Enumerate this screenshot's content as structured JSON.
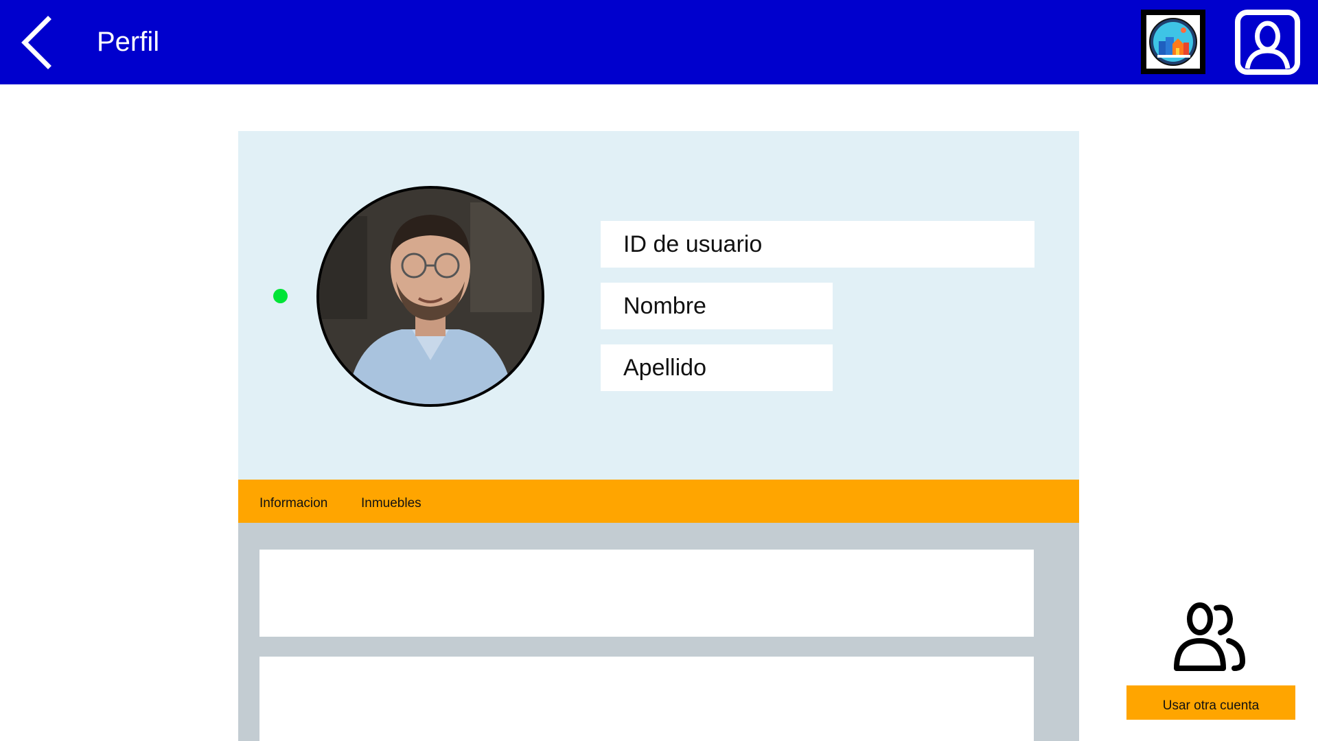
{
  "header": {
    "title": "Perfil",
    "back_icon": "chevron-left-icon",
    "logo_icon": "city-logo-icon",
    "account_icon": "user-account-icon"
  },
  "profile": {
    "status": "online",
    "avatar": "profile-photo",
    "fields": {
      "user_id_placeholder": "ID de usuario",
      "first_name_placeholder": "Nombre",
      "last_name_placeholder": "Apellido"
    }
  },
  "tabs": [
    {
      "label": "Informacion"
    },
    {
      "label": "Inmuebles"
    }
  ],
  "switch_account": {
    "icon": "users-icon",
    "label": "Usar otra cuenta"
  },
  "colors": {
    "header_bg": "#0000cd",
    "accent": "#ffa500",
    "card_bg": "#e1f0f6",
    "content_bg": "#c3ccd2",
    "status_online": "#00e436"
  }
}
